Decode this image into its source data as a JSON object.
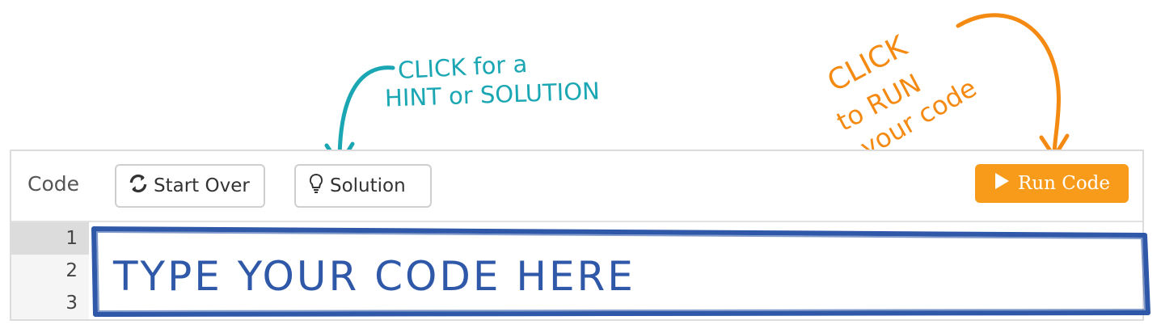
{
  "annotations": {
    "hint_line1": "CLICK for a",
    "hint_line2": "HINT or SOLUTION",
    "run_line1": "CLICK",
    "run_line2": "to RUN",
    "run_line3": "your code"
  },
  "toolbar": {
    "code_label": "Code",
    "start_over_label": "Start Over",
    "solution_label": "Solution",
    "run_label": "Run Code"
  },
  "editor": {
    "line_numbers": [
      "1",
      "2",
      "3"
    ],
    "active_line": "1",
    "overlay_text": "TYPE YOUR CODE HERE"
  },
  "colors": {
    "hint_annotation": "#1aa7b3",
    "run_annotation": "#f58a12",
    "run_button": "#f89b1a",
    "editor_frame": "#2f58a8"
  },
  "icons": {
    "start_over": "refresh-icon",
    "solution": "lightbulb-icon",
    "run": "play-icon"
  }
}
